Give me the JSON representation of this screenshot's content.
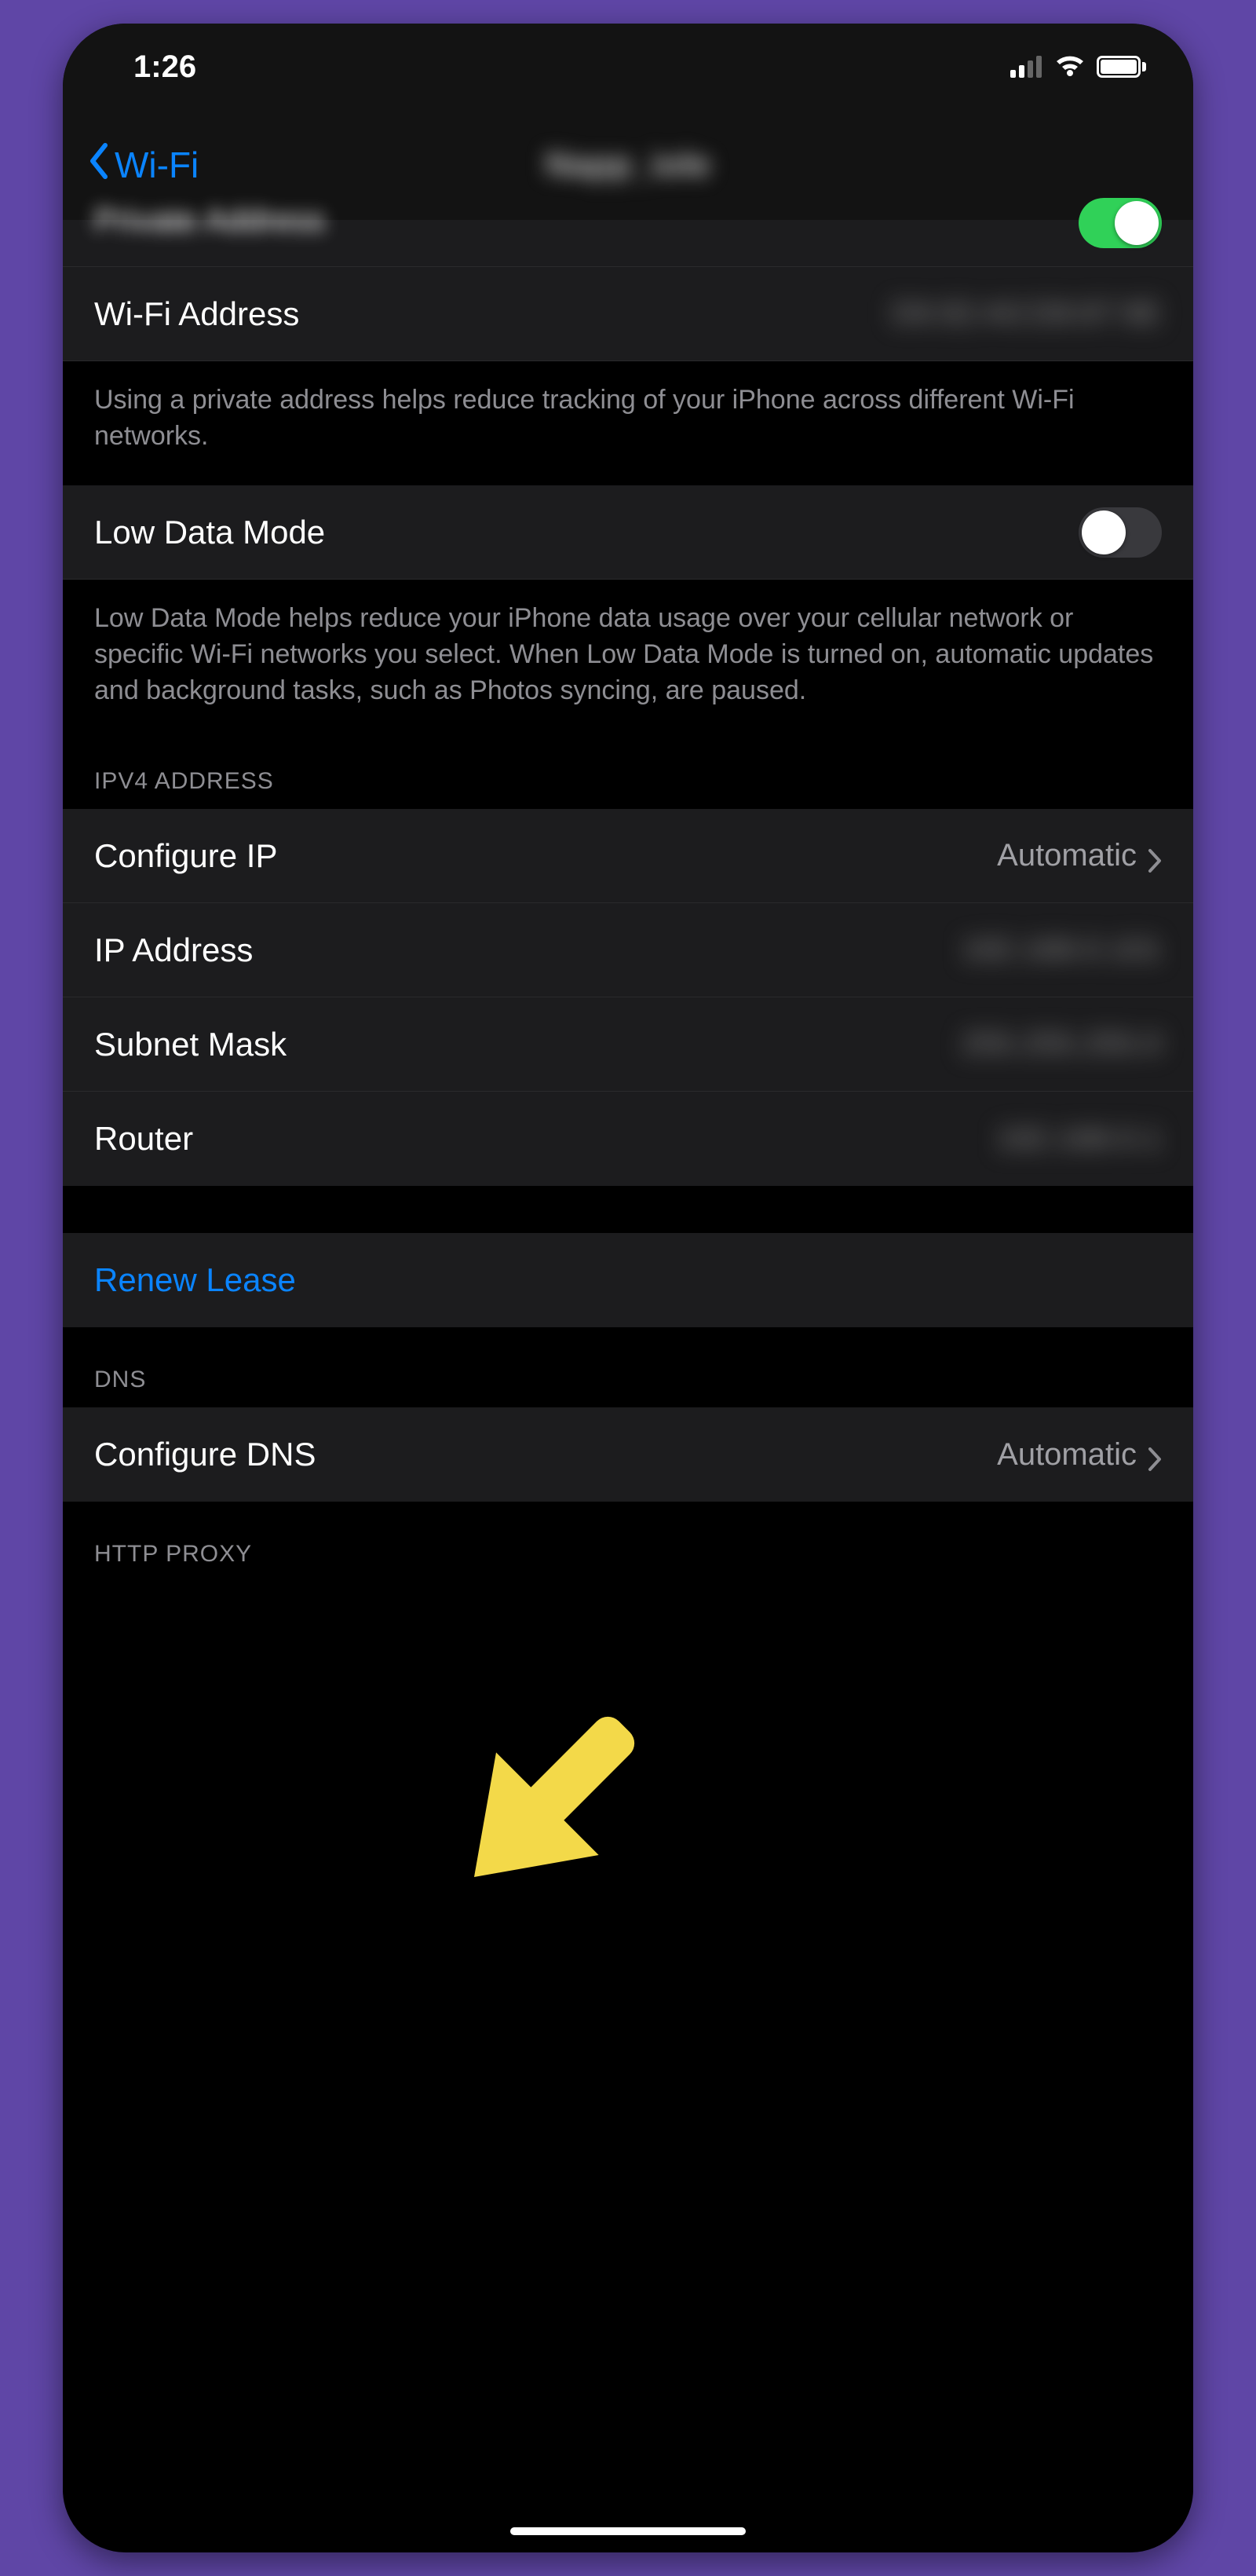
{
  "status": {
    "time": "1:26"
  },
  "nav": {
    "back_label": "Wi-Fi",
    "title": "Napp_iole"
  },
  "partial_row": {
    "label": "Private Address"
  },
  "wifi_address": {
    "label": "Wi-Fi Address",
    "value": "D6:92:A0:D8:87:9E"
  },
  "private_footer": "Using a private address helps reduce tracking of your iPhone across different Wi-Fi networks.",
  "low_data": {
    "label": "Low Data Mode",
    "on": false,
    "footer": "Low Data Mode helps reduce your iPhone data usage over your cellular network or specific Wi-Fi networks you select. When Low Data Mode is turned on, automatic updates and background tasks, such as Photos syncing, are paused."
  },
  "sections": {
    "ipv4": "IPV4 ADDRESS",
    "dns": "DNS",
    "http": "HTTP PROXY"
  },
  "ipv4": {
    "configure": {
      "label": "Configure IP",
      "value": "Automatic"
    },
    "ip": {
      "label": "IP Address",
      "value": "192.168.0.101"
    },
    "subnet": {
      "label": "Subnet Mask",
      "value": "255.255.255.0"
    },
    "router": {
      "label": "Router",
      "value": "192.168.0.1"
    }
  },
  "renew_label": "Renew Lease",
  "dns": {
    "configure": {
      "label": "Configure DNS",
      "value": "Automatic"
    }
  },
  "colors": {
    "accent": "#0a84ff",
    "toggle_on": "#30d158",
    "arrow": "#f3d949",
    "bg": "#5f46a6"
  }
}
